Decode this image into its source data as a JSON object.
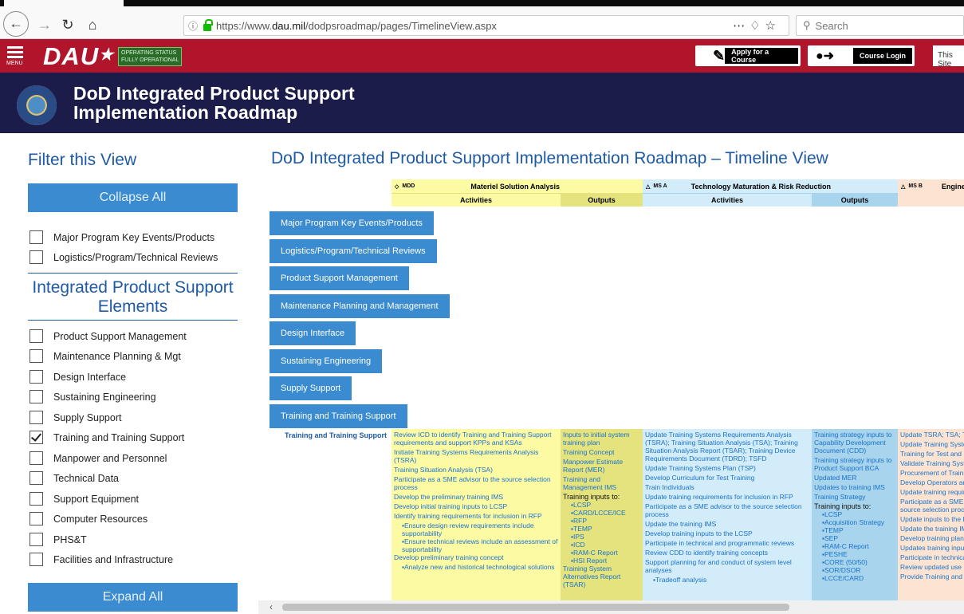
{
  "browser": {
    "url_prefix": "https://www.",
    "url_domain": "dau.mil",
    "url_path": "/dodpsroadmap/pages/TimelineView.aspx",
    "search_placeholder": "Search"
  },
  "header": {
    "menu_label": "MENU",
    "logo": "DAU",
    "status_line1": "OPERATING STATUS",
    "status_line2": "FULLY OPERATIONAL",
    "apply_label": "Apply for a Course",
    "login_label": "Course Login",
    "site_search": "This Site",
    "title_line1": "DoD Integrated Product Support",
    "title_line2": "Implementation Roadmap"
  },
  "filter": {
    "title": "Filter this View",
    "collapse_label": "Collapse All",
    "expand_label": "Expand All",
    "top_items": [
      {
        "label": "Major Program Key Events/Products",
        "checked": false
      },
      {
        "label": "Logistics/Program/Technical Reviews",
        "checked": false
      }
    ],
    "ips_title": "Integrated Product Support Elements",
    "ips_items": [
      {
        "label": "Product Support Management",
        "checked": false
      },
      {
        "label": "Maintenance Planning & Mgt",
        "checked": false
      },
      {
        "label": "Design Interface",
        "checked": false
      },
      {
        "label": "Sustaining Engineering",
        "checked": false
      },
      {
        "label": "Supply Support",
        "checked": false
      },
      {
        "label": "Training and Training Support",
        "checked": true
      },
      {
        "label": "Manpower and Personnel",
        "checked": false
      },
      {
        "label": "Technical Data",
        "checked": false
      },
      {
        "label": "Support Equipment",
        "checked": false
      },
      {
        "label": "Computer Resources",
        "checked": false
      },
      {
        "label": "PHS&T",
        "checked": false
      },
      {
        "label": "Facilities and Infrastructure",
        "checked": false
      }
    ]
  },
  "main": {
    "title": "DoD Integrated Product Support Implementation Roadmap – Timeline View",
    "phases": [
      {
        "ms": "MDD",
        "name": "Materiel Solution Analysis",
        "activities": "Activities",
        "outputs": "Outputs"
      },
      {
        "ms": "MS A",
        "name": "Technology Maturation & Risk Reduction",
        "activities": "Activities",
        "outputs": "Outputs"
      },
      {
        "ms": "MS B",
        "name": "Engine"
      }
    ],
    "accordions": [
      "Major Program Key Events/Products",
      "Logistics/Program/Technical Reviews",
      "Product Support Management",
      "Maintenance Planning and Management",
      "Design Interface",
      "Sustaining Engineering",
      "Supply Support",
      "Training and Training Support"
    ],
    "row_label": "Training and Training Support",
    "col1": {
      "items": [
        "Review ICD to identify Training and Training Support requirements and support KPPs and KSAs",
        "Initiate Training Systems Requirements Analysis (TSRA)",
        "Training Situation Analysis (TSA)",
        "Participate as a SME advisor to the source selection process",
        "Develop the preliminary training IMS",
        "Develop initial training inputs to LCSP",
        "Identify training requirements for inclusion in RFP"
      ],
      "bullets": [
        "Ensure design review requirements include supportability",
        "Ensure technical reviews include an assessment of supportability"
      ],
      "item_after": "Develop preliminary training concept",
      "bullets2": [
        "Analyze new and historical technological solutions"
      ]
    },
    "col2": {
      "items": [
        "Inputs to initial system training plan",
        "Training Concept",
        "Manpower Estimate Report (MER)",
        "Training and Management IMS"
      ],
      "sub": "Training inputs to:",
      "bullets": [
        "LCSP",
        "CARD/LCCE/ICE",
        "RFP",
        "TEMP",
        "IPS",
        "ICD",
        "RAM-C Report",
        "HSI Report"
      ],
      "item_after": "Training System Alternatives Report (TSAR)"
    },
    "col3": {
      "items": [
        "Update Training Systems Requirements Analysis (TSRA); Training Situation Analysis (TSA); Training Situation Analysis Report (TSAR); Training Device Requirements Document (TDRD); TSFD",
        "Update Training Systems Plan (TSP)",
        "Develop Curriculum for Test Training",
        "Train Individuals",
        "Update training requirements for inclusion in RFP",
        "Participate as a SME advisor to the source selection process",
        "Update the training IMS",
        "Develop training inputs to the LCSP",
        "Participate in technical and programmatic reviews",
        "Review CDD to identify training concepts",
        "Support planning for and conduct of system level analyses"
      ],
      "bullets": [
        "Tradeoff analysis"
      ]
    },
    "col4": {
      "items": [
        "Training strategy inputs to Capability Development Document (CDD)",
        "Training strategy inputs to Product Support BCA",
        "Updated MER",
        "Updates to training IMS",
        "Training Strategy"
      ],
      "sub": "Training inputs to:",
      "bullets": [
        "LCSP",
        "Acquisition Strategy",
        "TEMP",
        "SEP",
        "RAM-C Report",
        "PESHE",
        "CORE (50/50)",
        "SOR/DSOR",
        "LCCE/CARD"
      ]
    },
    "col5": {
      "items": [
        "Update TSRA; TSA; TSAR; TDRD",
        "Update Training System Plan",
        "Training for Test and Evaluation",
        "Validate Training System",
        "Procurement of Training",
        "Develop Operators and Maintainers",
        "Update training requirements",
        "Participate as a SME advisor to the source selection process",
        "Update inputs to the LCSP",
        "Update the training IMS",
        "Develop training plans",
        "Updates training inputs",
        "Participate in technical reviews",
        "Review updated use",
        "Provide Training and"
      ]
    },
    "colors": {
      "msa_light": "#fdfaa4",
      "msa_dark": "#e5e37e",
      "tmrr_light": "#d3ecfa",
      "tmrr_dark": "#a8d4ee",
      "emd_light": "#fde4d2"
    }
  }
}
